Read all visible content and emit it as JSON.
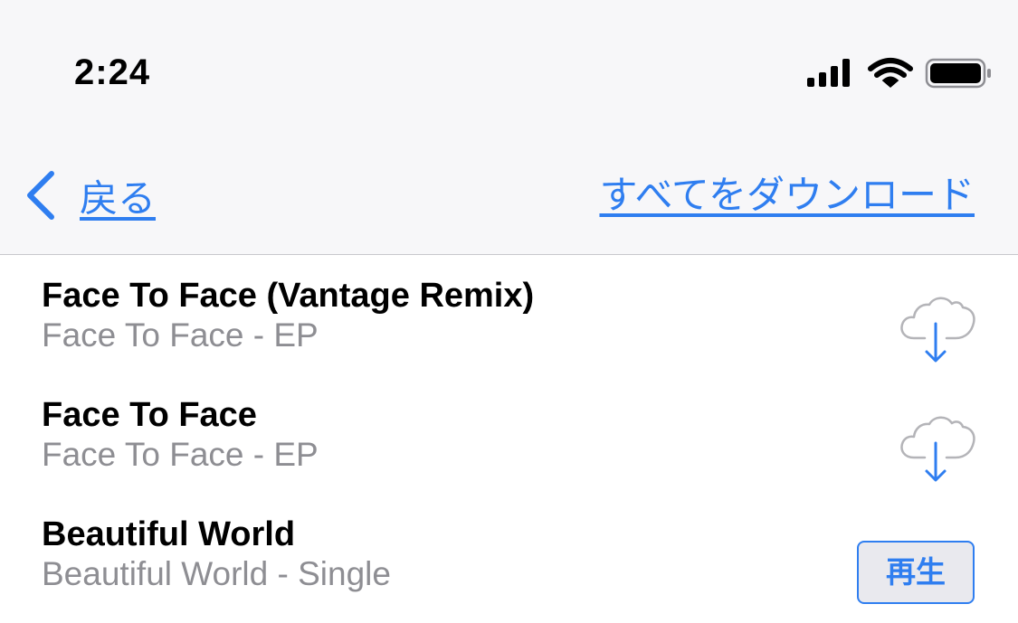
{
  "status_bar": {
    "time": "2:24",
    "icons": [
      "cellular-signal-icon",
      "wifi-icon",
      "battery-icon"
    ]
  },
  "nav": {
    "back_label": "戻る",
    "download_all_label": "すべてをダウンロード"
  },
  "colors": {
    "accent": "#2f7ef0",
    "secondary_text": "#8e8e93",
    "cloud_outline": "#b4b4b8"
  },
  "tracks": [
    {
      "title": "Face To Face (Vantage Remix)",
      "subtitle": "Face To Face - EP",
      "action": "download"
    },
    {
      "title": "Face To Face",
      "subtitle": "Face To Face - EP",
      "action": "download"
    },
    {
      "title": "Beautiful World",
      "subtitle": "Beautiful World - Single",
      "action": "play",
      "action_label": "再生"
    }
  ]
}
